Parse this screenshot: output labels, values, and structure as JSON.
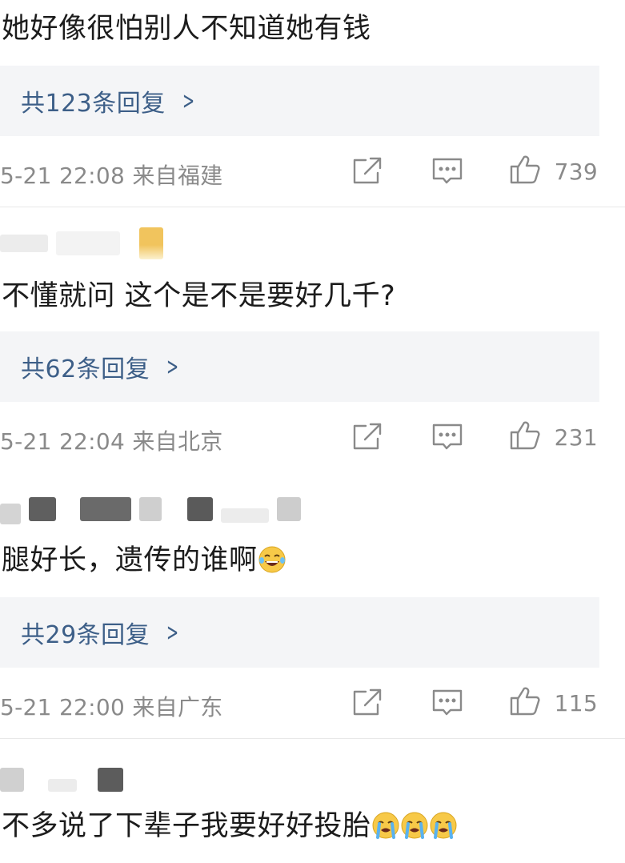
{
  "comments": [
    {
      "text": "她好像很怕别人不知道她有钱",
      "reply_label": "共123条回复",
      "time_location": "5-21 22:08 来自福建",
      "likes": "739"
    },
    {
      "username": "",
      "text": "不懂就问 这个是不是要好几千?",
      "reply_label": "共62条回复",
      "time_location": "5-21 22:04 来自北京",
      "likes": "231"
    },
    {
      "username": "",
      "text": "腿好长，遗传的谁啊",
      "emoji": [
        "laughing-tears-emoji"
      ],
      "reply_label": "共29条回复",
      "time_location": "5-21 22:00 来自广东",
      "likes": "115"
    },
    {
      "username": "",
      "text": "不多说了下辈子我要好好投胎",
      "emoji": [
        "crying-emoji",
        "crying-emoji",
        "crying-emoji"
      ]
    }
  ],
  "icons": {
    "share": "share-icon",
    "comment": "comment-icon",
    "like": "thumbs-up-icon",
    "chevron": "chevron-right-icon"
  },
  "colors": {
    "reply_link": "#3d5f88",
    "reply_bg": "#f4f5f7",
    "meta_text": "#8a8a8a",
    "divider": "#e8e8e8"
  }
}
